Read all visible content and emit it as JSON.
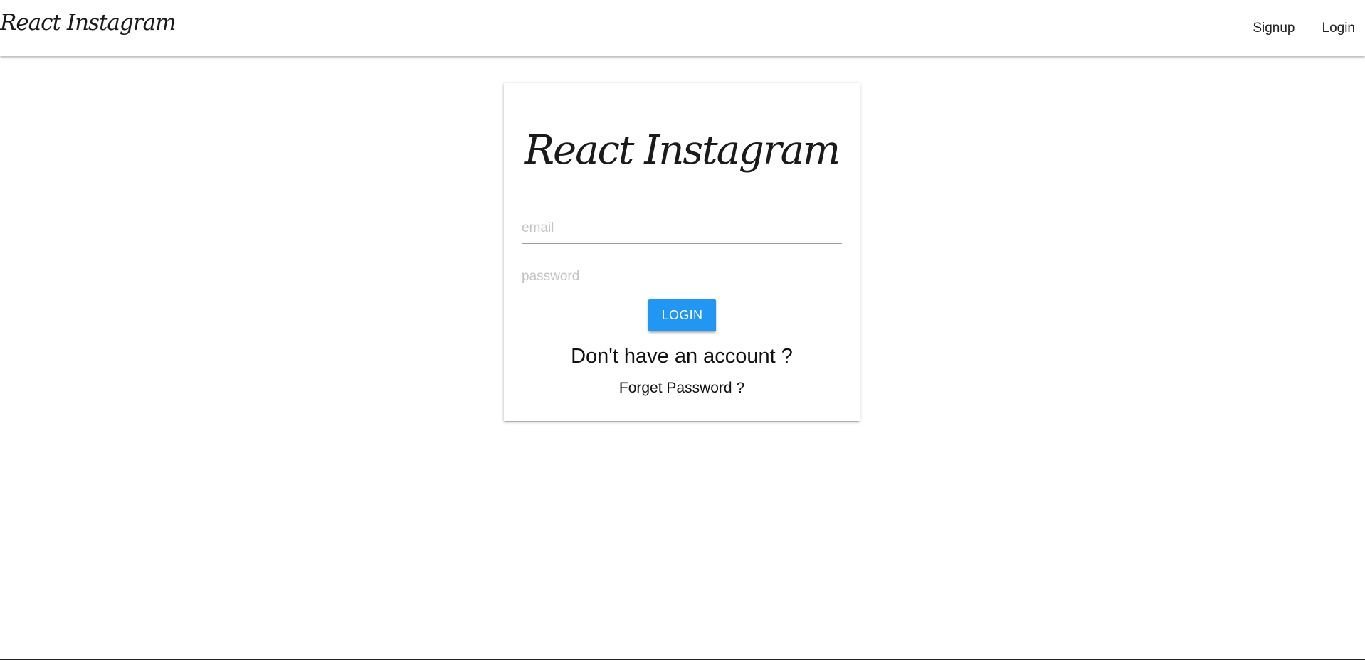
{
  "navbar": {
    "brand": "React Instagram",
    "links": [
      {
        "label": "Signup"
      },
      {
        "label": "Login"
      }
    ]
  },
  "login_card": {
    "title": "React Instagram",
    "email_placeholder": "email",
    "password_placeholder": "password",
    "login_button": "LOGIN",
    "signup_prompt": "Don't have an account ?",
    "forgot_password": "Forget Password ?"
  },
  "colors": {
    "primary_button": "#2196f3",
    "background": "#ffffff",
    "text": "#222222"
  }
}
